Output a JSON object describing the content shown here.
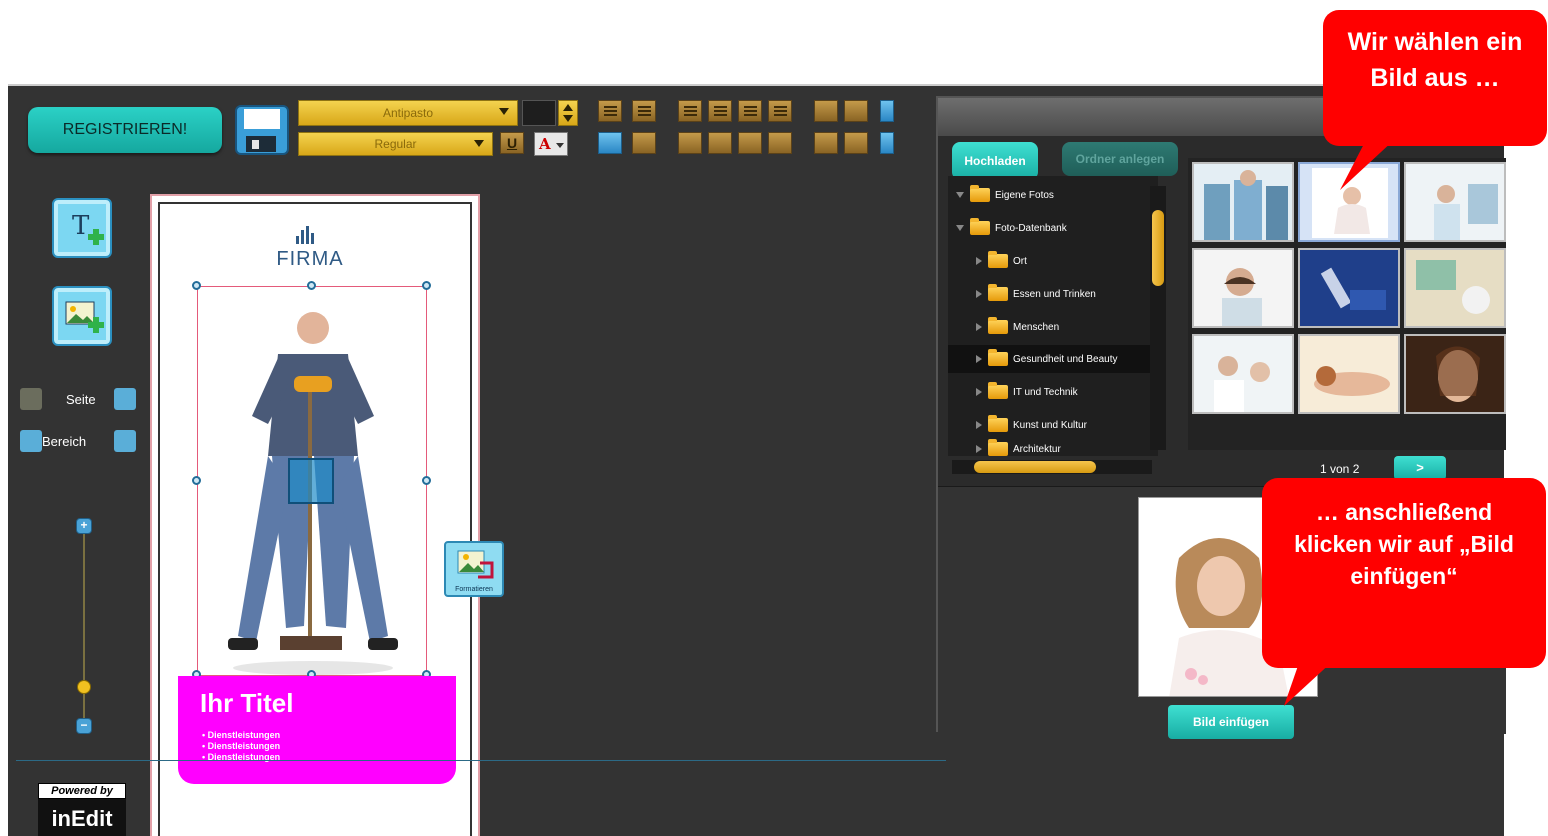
{
  "editor": {
    "register_label": "REGISTRIEREN!",
    "font_name": "Antipasto",
    "font_style": "Regular",
    "underline_label": "U",
    "text_color_label": "A",
    "nav": {
      "page_label": "Seite",
      "area_label": "Bereich"
    },
    "zoom": {
      "plus": "+",
      "minus": "−",
      "level": 0.18
    },
    "powered_by": "Powered by",
    "powered_brand": "inEdit"
  },
  "canvas": {
    "logo_text": "FIRMA",
    "title": "Ihr Titel",
    "bullets": [
      "• Dienstleistungen",
      "• Dienstleistungen",
      "• Dienstleistungen"
    ],
    "format_button_label": "Formatieren"
  },
  "dialog": {
    "upload_label": "Hochladen",
    "new_folder_label": "Ordner anlegen",
    "tree": [
      {
        "label": "Eigene Fotos",
        "level": 0,
        "expanded": true
      },
      {
        "label": "Foto-Datenbank",
        "level": 0,
        "expanded": true
      },
      {
        "label": "Ort",
        "level": 1
      },
      {
        "label": "Essen und Trinken",
        "level": 1
      },
      {
        "label": "Menschen",
        "level": 1
      },
      {
        "label": "Gesundheit und Beauty",
        "level": 1,
        "selected": true
      },
      {
        "label": "IT und Technik",
        "level": 1
      },
      {
        "label": "Kunst und Kultur",
        "level": 1
      },
      {
        "label": "Architektur",
        "level": 1
      }
    ],
    "pager": {
      "text": "1 von 2",
      "next_label": ">"
    },
    "insert_label": "Bild einfügen"
  },
  "callouts": {
    "top": "Wir wählen ein Bild aus …",
    "bottom": "… anschließend klicken wir auf „Bild einfügen“"
  },
  "colors": {
    "accent_teal": "#20c0b6",
    "callout_red": "#ff0000",
    "title_magenta": "#ff00ff"
  }
}
